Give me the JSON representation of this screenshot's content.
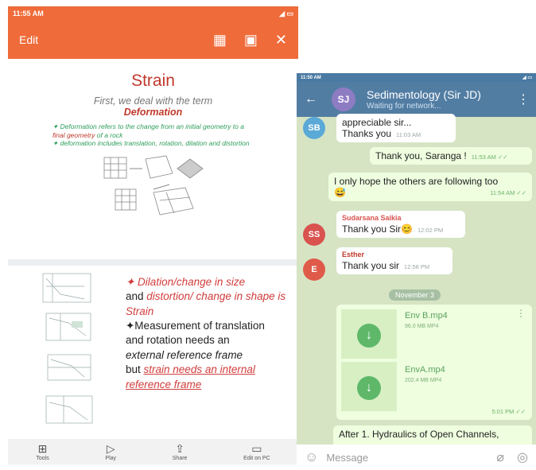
{
  "left": {
    "status_time": "11:55 AM",
    "status_icons": "◢ ▭",
    "toolbar": {
      "edit": "Edit",
      "grid_glyph": "▦",
      "slide_glyph": "▣",
      "close_glyph": "✕"
    },
    "slide1": {
      "title": "Strain",
      "subtitle": "First, we deal with the term",
      "term": "Deformation",
      "bullet1a": "✦ Deformation refers to the change from an initial geometry to a ",
      "bullet1b": "final geometry",
      "bullet1c": " of a rock",
      "bullet2": "✦ deformation includes translation, rotation, dilation and distortion"
    },
    "slide2": {
      "line1": "✦ Dilation/change in size",
      "line2a": "and ",
      "line2b": "distortion/ change in shape is Strain",
      "line3": "✦Measurement of translation",
      "line4": "and rotation needs an",
      "line5": "external reference frame",
      "line6a": "but ",
      "line6b": "strain needs an internal reference frame"
    },
    "bottom_bar": [
      {
        "glyph": "⊞",
        "label": "Tools"
      },
      {
        "glyph": "▷",
        "label": "Play"
      },
      {
        "glyph": "⇪",
        "label": "Share"
      },
      {
        "glyph": "▭",
        "label": "Edit on PC"
      }
    ]
  },
  "right": {
    "status_time": "11:50 AM",
    "status_icons": "◢ ▭",
    "header": {
      "back": "←",
      "avatar": "SJ",
      "title": "Sedimentology (Sir JD)",
      "subtitle": "Waiting for network...",
      "menu": "⋮"
    },
    "messages": [
      {
        "avatar": "SB",
        "avatar_color": "#5aa9d6",
        "line1": "appreciable sir...",
        "line2": "Thanks you",
        "time": "11:03 AM"
      },
      {
        "text": "Thank you, Saranga !",
        "time": "11:53 AM ✓✓"
      },
      {
        "text": "I only hope the others are following too",
        "emoji": "😅",
        "time": "11:54 AM ✓✓"
      },
      {
        "avatar": "SS",
        "avatar_color": "#d9534f",
        "sender": "Sudarsana Saikia",
        "sender_color": "#d9534f",
        "text": "Thank you Sir😊",
        "time": "12:02 PM"
      },
      {
        "avatar": "E",
        "avatar_color": "#e05a4a",
        "sender": "Esther",
        "sender_color": "#c0392b",
        "text": "Thank you sir",
        "time": "12:58 PM"
      }
    ],
    "date_pill": "November 3",
    "files": [
      {
        "name": "Env B.mp4",
        "size": "96.0 MB MP4"
      },
      {
        "name": "EnvA.mp4",
        "size": "202.4 MB MP4"
      }
    ],
    "files_time": "5:01 PM ✓✓",
    "file_menu": "⋮",
    "download_glyph": "↓",
    "last_message": "After 1. Hydraulics of Open Channels,",
    "input": {
      "smile": "☺",
      "placeholder": "Message",
      "attach": "⌀",
      "camera": "◎"
    }
  }
}
